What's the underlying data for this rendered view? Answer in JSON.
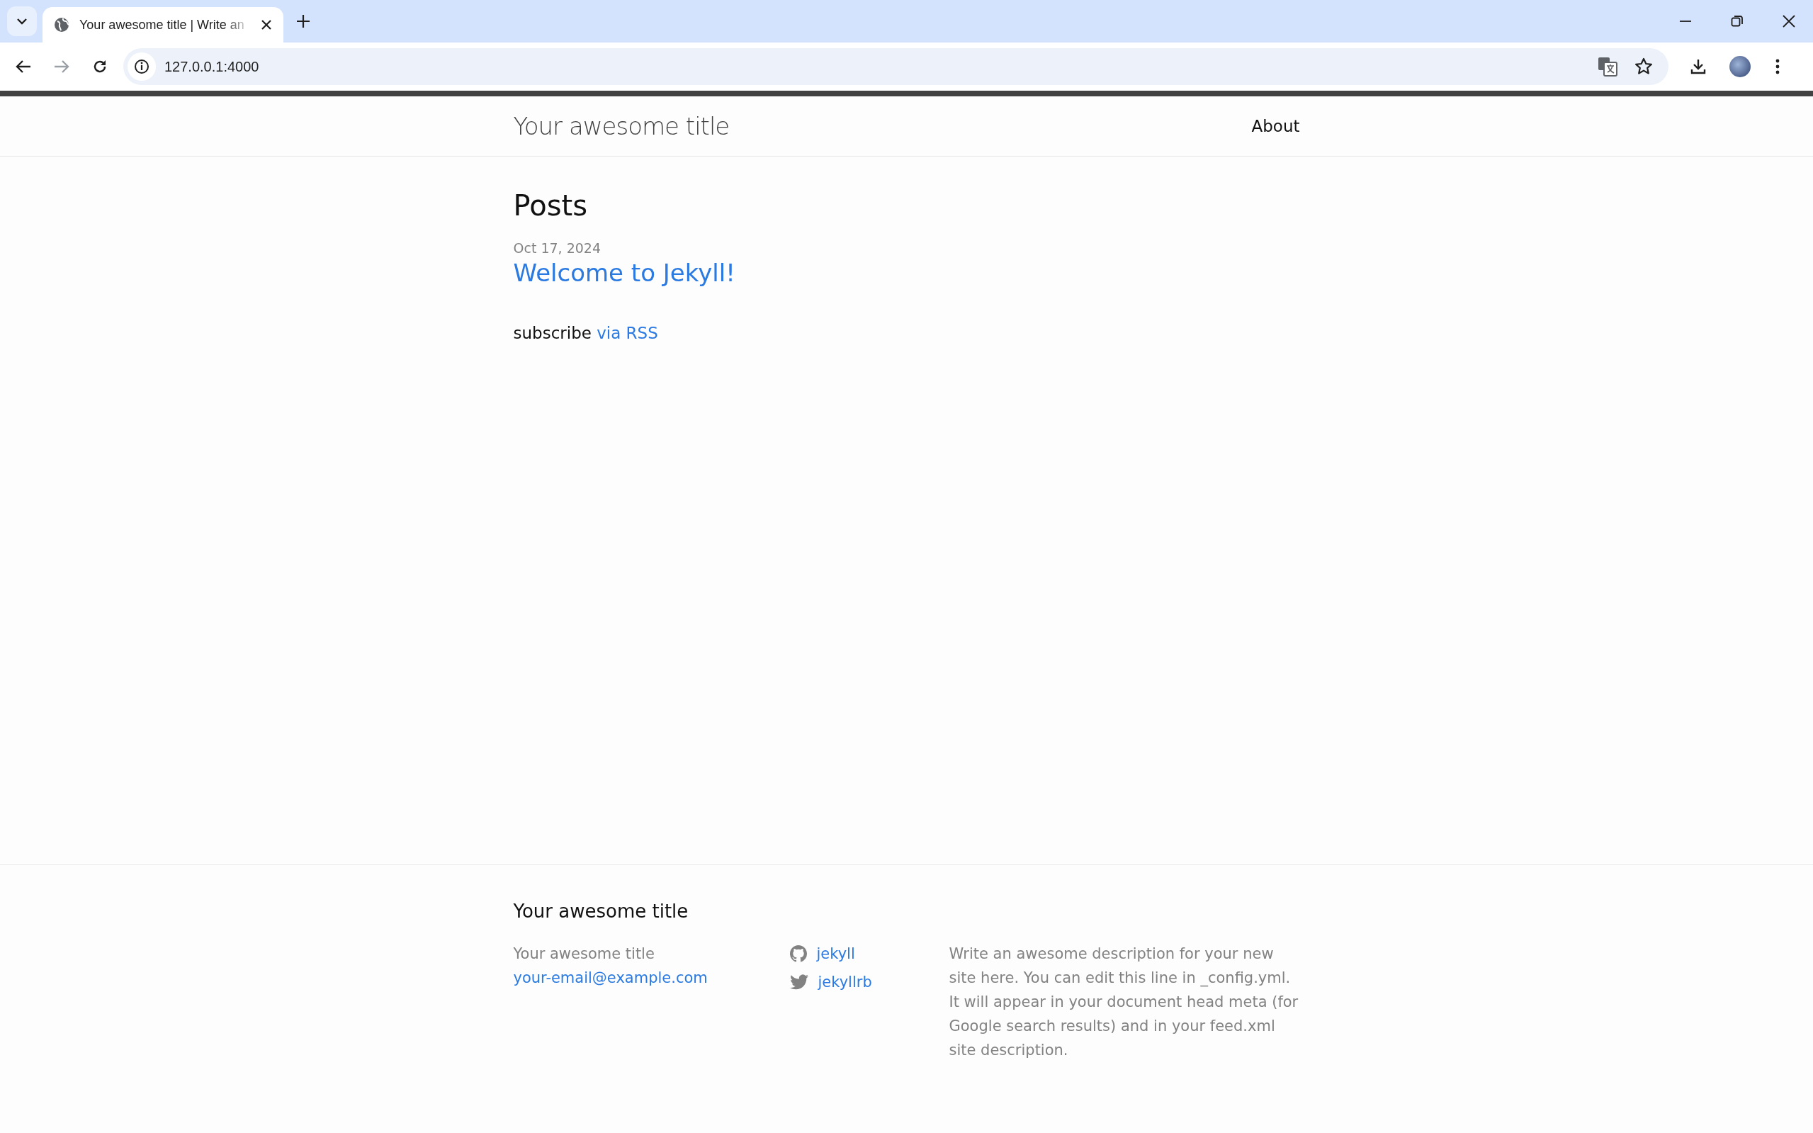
{
  "browser": {
    "tabs": [
      {
        "title": "Your awesome title | Write an",
        "selected": true
      }
    ],
    "back_disabled": false,
    "forward_disabled": true,
    "url": "127.0.0.1:4000"
  },
  "header": {
    "site_title": "Your awesome title",
    "nav": [
      "About"
    ]
  },
  "main": {
    "heading": "Posts",
    "posts": [
      {
        "date": "Oct 17, 2024",
        "title": "Welcome to Jekyll!"
      }
    ],
    "subscribe": {
      "text": "subscribe",
      "link": "via RSS"
    }
  },
  "footer": {
    "heading": "Your awesome title",
    "name": "Your awesome title",
    "email": "your-email@example.com",
    "social": [
      {
        "kind": "github",
        "label": "jekyll"
      },
      {
        "kind": "twitter",
        "label": "jekyllrb"
      }
    ],
    "description": "Write an awesome description for your new site here. You can edit this line in _config.yml. It will appear in your document head meta (for Google search results) and in your feed.xml site description."
  }
}
